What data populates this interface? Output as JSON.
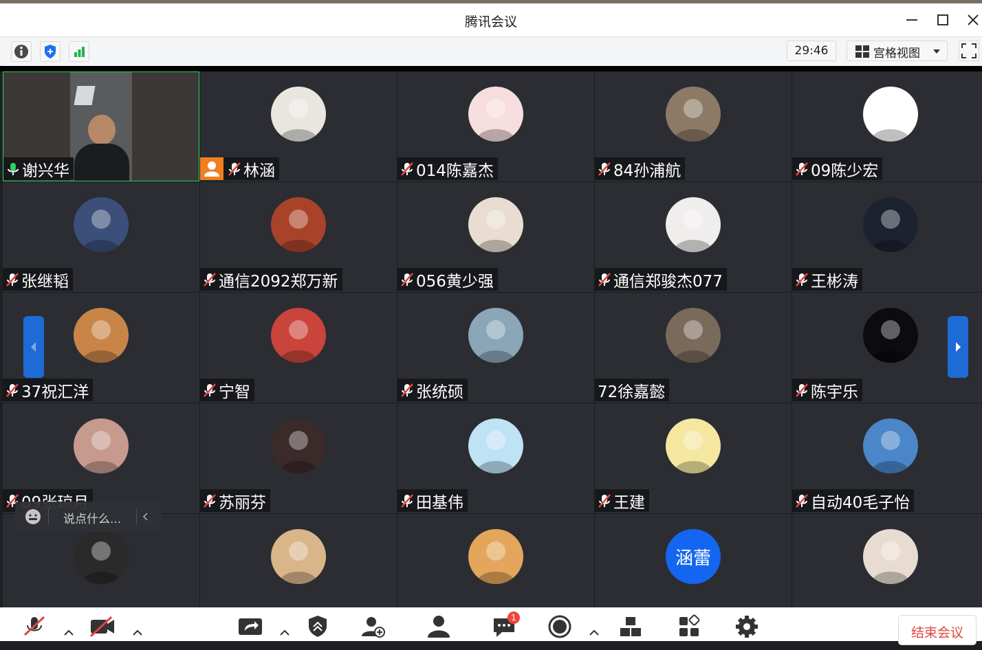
{
  "window": {
    "title": "腾讯会议"
  },
  "toolbar": {
    "timer": "29:46",
    "view_label": "宫格视图"
  },
  "participants": [
    {
      "name": "谢兴华",
      "mic": "on",
      "video": true
    },
    {
      "name": "林涵",
      "mic": "muted",
      "host": true,
      "avatar_color": "#e9e6e0"
    },
    {
      "name": "014陈嘉杰",
      "mic": "muted",
      "avatar_color": "#f6dede"
    },
    {
      "name": "84孙浦航",
      "mic": "muted",
      "avatar_color": "#8c7a66"
    },
    {
      "name": "09陈少宏",
      "mic": "muted",
      "avatar_color": "#ffffff"
    },
    {
      "name": "张继韬",
      "mic": "muted",
      "avatar_color": "#3b4f7a"
    },
    {
      "name": "通信2092郑万新",
      "mic": "muted",
      "avatar_color": "#a8432a"
    },
    {
      "name": "056黄少强",
      "mic": "muted",
      "avatar_color": "#e8ddd0"
    },
    {
      "name": "通信郑骏杰077",
      "mic": "muted",
      "avatar_color": "#f0eded"
    },
    {
      "name": "王彬涛",
      "mic": "muted",
      "avatar_color": "#1d2230"
    },
    {
      "name": "37祝汇洋",
      "mic": "muted",
      "avatar_color": "#c98548"
    },
    {
      "name": "宁智",
      "mic": "muted",
      "avatar_color": "#c9443a"
    },
    {
      "name": "张统硕",
      "mic": "muted",
      "avatar_color": "#8aa6b8"
    },
    {
      "name": "72徐嘉懿",
      "mic": "none",
      "avatar_color": "#7a6a5a"
    },
    {
      "name": "陈宇乐",
      "mic": "muted",
      "avatar_color": "#0b0b10"
    },
    {
      "name": "09张琼月",
      "mic": "muted",
      "avatar_color": "#c79a8e"
    },
    {
      "name": "苏丽芬",
      "mic": "muted",
      "avatar_color": "#3a2a2a"
    },
    {
      "name": "田基伟",
      "mic": "muted",
      "avatar_color": "#bfe2f5"
    },
    {
      "name": "王建",
      "mic": "muted",
      "avatar_color": "#f5e7a0"
    },
    {
      "name": "自动40毛子怡",
      "mic": "muted",
      "avatar_color": "#4a86c8"
    },
    {
      "name": "",
      "mic": "none",
      "avatar_color": "#2a2a2a"
    },
    {
      "name": "",
      "mic": "none",
      "avatar_color": "#d9b58a"
    },
    {
      "name": "",
      "mic": "none",
      "avatar_color": "#e3a65a"
    },
    {
      "name": "",
      "mic": "none",
      "avatar_text": "涵蕾",
      "avatar_color": "#1466f0"
    },
    {
      "name": "",
      "mic": "none",
      "avatar_color": "#e8dcd2"
    }
  ],
  "chat": {
    "placeholder": "说点什么..."
  },
  "bottombar": {
    "end_label": "结束会议",
    "chat_badge": "1"
  }
}
